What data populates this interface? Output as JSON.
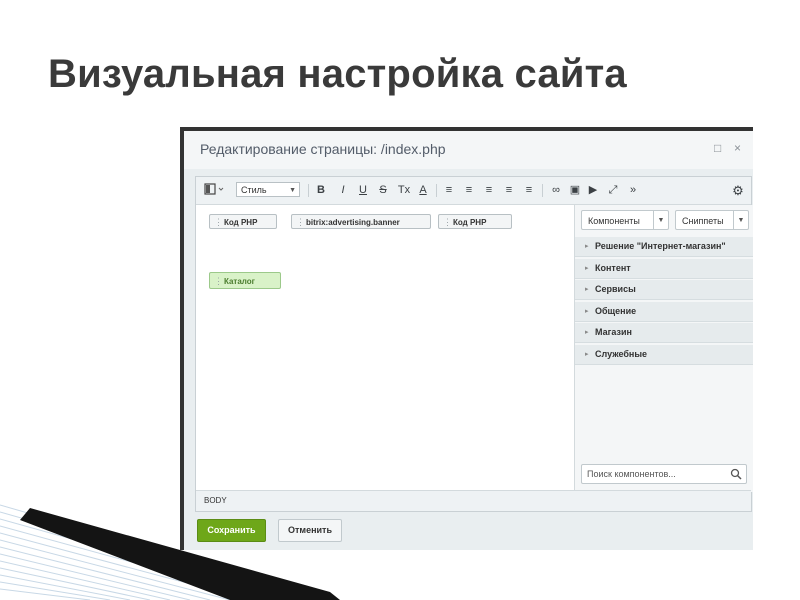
{
  "slide": {
    "title": "Визуальная настройка сайта"
  },
  "window": {
    "title": "Редактирование страницы: /index.php",
    "buttons": {
      "maximize": "□",
      "close": "×"
    }
  },
  "toolbar": {
    "style_label": "Стиль",
    "bold": "B",
    "italic": "I",
    "underline": "U",
    "strike": "S",
    "clear_format": "Tx",
    "font_color": "A",
    "ordered_list": "≡",
    "unordered_list": "≡",
    "outdent": "≡",
    "indent": "≡",
    "align": "≡",
    "link": "∞",
    "image": "▣",
    "video": "▶",
    "fullscreen": "⤢",
    "more": "»",
    "settings": "⚙"
  },
  "content": {
    "blocks": [
      {
        "label": "Код PHP"
      },
      {
        "label": "bitrix:advertising.banner"
      },
      {
        "label": "Код PHP"
      },
      {
        "label": "Каталог"
      }
    ]
  },
  "sidepanel": {
    "components_btn": "Компоненты",
    "snippets_btn": "Сниппеты",
    "categories": [
      "Решение \"Интернет-магазин\"",
      "Контент",
      "Сервисы",
      "Общение",
      "Магазин",
      "Служебные"
    ],
    "search_placeholder": "Поиск компонентов..."
  },
  "status": {
    "path": "BODY"
  },
  "footer": {
    "save": "Сохранить",
    "cancel": "Отменить"
  },
  "colors": {
    "save_green": "#6ea719",
    "catalog_block": "#d9f2c8",
    "title_text": "#3a3a3a"
  }
}
